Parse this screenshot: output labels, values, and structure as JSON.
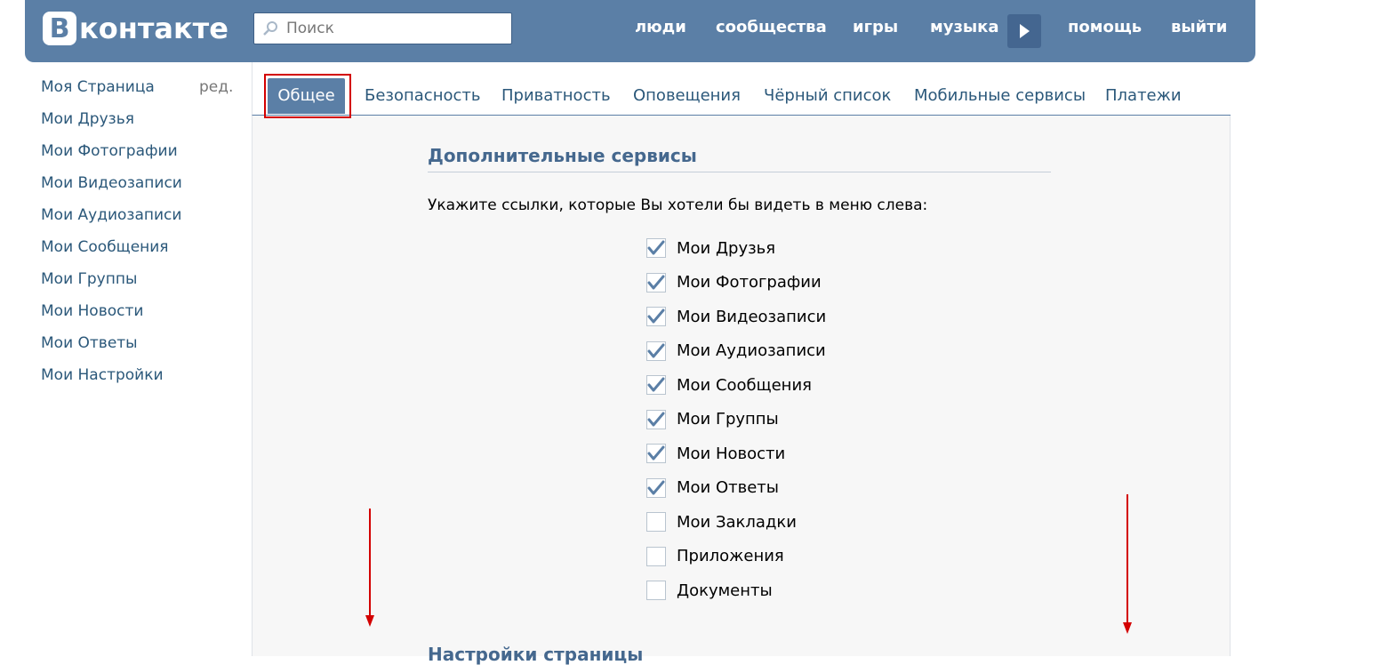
{
  "header": {
    "logo_letter": "В",
    "logo_text": "контакте",
    "search_placeholder": "Поиск",
    "nav": [
      "люди",
      "сообщества",
      "игры",
      "музыка",
      "помощь",
      "выйти"
    ]
  },
  "sidebar": {
    "edit_label": "ред.",
    "items": [
      {
        "label": "Моя Страница"
      },
      {
        "label": "Мои Друзья"
      },
      {
        "label": "Мои Фотографии"
      },
      {
        "label": "Мои Видеозаписи"
      },
      {
        "label": "Мои Аудиозаписи"
      },
      {
        "label": "Мои Сообщения"
      },
      {
        "label": "Мои Группы"
      },
      {
        "label": "Мои Новости"
      },
      {
        "label": "Мои Ответы"
      },
      {
        "label": "Мои Настройки"
      }
    ]
  },
  "tabs": [
    {
      "label": "Общее",
      "active": true
    },
    {
      "label": "Безопасность"
    },
    {
      "label": "Приватность"
    },
    {
      "label": "Оповещения"
    },
    {
      "label": "Чёрный список"
    },
    {
      "label": "Мобильные сервисы"
    },
    {
      "label": "Платежи"
    }
  ],
  "main": {
    "section_title": "Дополнительные сервисы",
    "hint": "Укажите ссылки, которые Вы хотели бы видеть в меню слева:",
    "options": [
      {
        "label": "Мои Друзья",
        "checked": true
      },
      {
        "label": "Мои Фотографии",
        "checked": true
      },
      {
        "label": "Мои Видеозаписи",
        "checked": true
      },
      {
        "label": "Мои Аудиозаписи",
        "checked": true
      },
      {
        "label": "Мои Сообщения",
        "checked": true
      },
      {
        "label": "Мои Группы",
        "checked": true
      },
      {
        "label": "Мои Новости",
        "checked": true
      },
      {
        "label": "Мои Ответы",
        "checked": true
      },
      {
        "label": "Мои Закладки",
        "checked": false
      },
      {
        "label": "Приложения",
        "checked": false
      },
      {
        "label": "Документы",
        "checked": false
      }
    ],
    "next_section_title": "Настройки страницы"
  },
  "colors": {
    "header_bg": "#5b7fa6",
    "link": "#2b587a",
    "annotation": "#d30000"
  }
}
